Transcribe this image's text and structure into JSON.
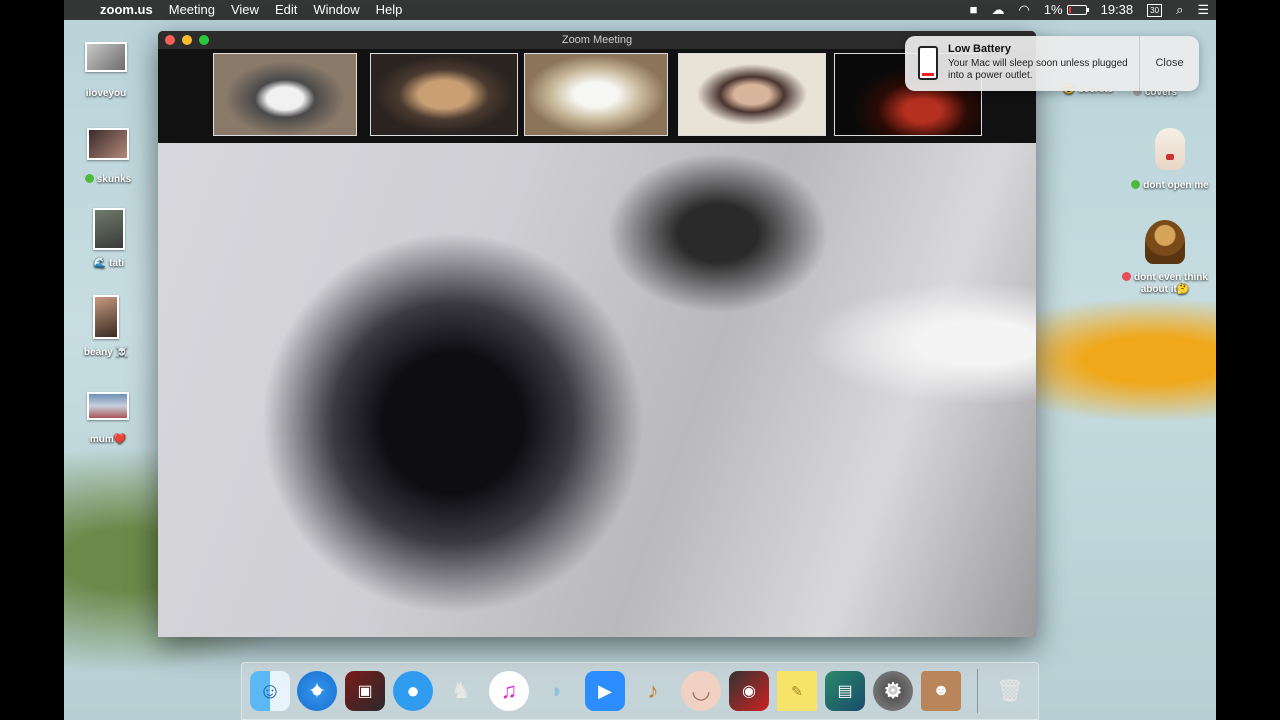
{
  "menubar": {
    "app_name": "zoom.us",
    "menus": [
      "Meeting",
      "View",
      "Edit",
      "Window",
      "Help"
    ],
    "battery_percent": "1%",
    "time": "19:38",
    "calendar_day": "30"
  },
  "desktop_left": [
    {
      "label": "iloveyou"
    },
    {
      "label": "skunks",
      "tag_color": "#4cbb3c"
    },
    {
      "label": "tati",
      "emoji": "🌊"
    },
    {
      "label": "beany",
      "emoji": "☠️"
    },
    {
      "label": "mum",
      "emoji": "❤️"
    }
  ],
  "desktop_right": [
    {
      "label": "secrets",
      "emoji": "😮"
    },
    {
      "label": "covers",
      "tag_color": "#a0a0a0"
    },
    {
      "label": "dont open me",
      "tag_color": "#4cbb3c"
    },
    {
      "label": "dont even think about it",
      "emoji": "🤔",
      "tag_color": "#e84c5a"
    }
  ],
  "zoom": {
    "title": "Zoom Meeting"
  },
  "notification": {
    "title": "Low Battery",
    "body": "Your Mac will sleep soon unless plugged into a power outlet.",
    "close_label": "Close"
  },
  "dock": {
    "apps": [
      "finder-icon",
      "safari-icon",
      "photo-booth-icon",
      "messages-icon",
      "creature-icon",
      "itunes-icon",
      "sealion-icon",
      "zoom-icon",
      "garageband-icon",
      "face-icon",
      "media-icon",
      "stickies-icon",
      "preview-icon",
      "system-preferences-icon",
      "contacts-icon",
      "trash-icon"
    ]
  }
}
